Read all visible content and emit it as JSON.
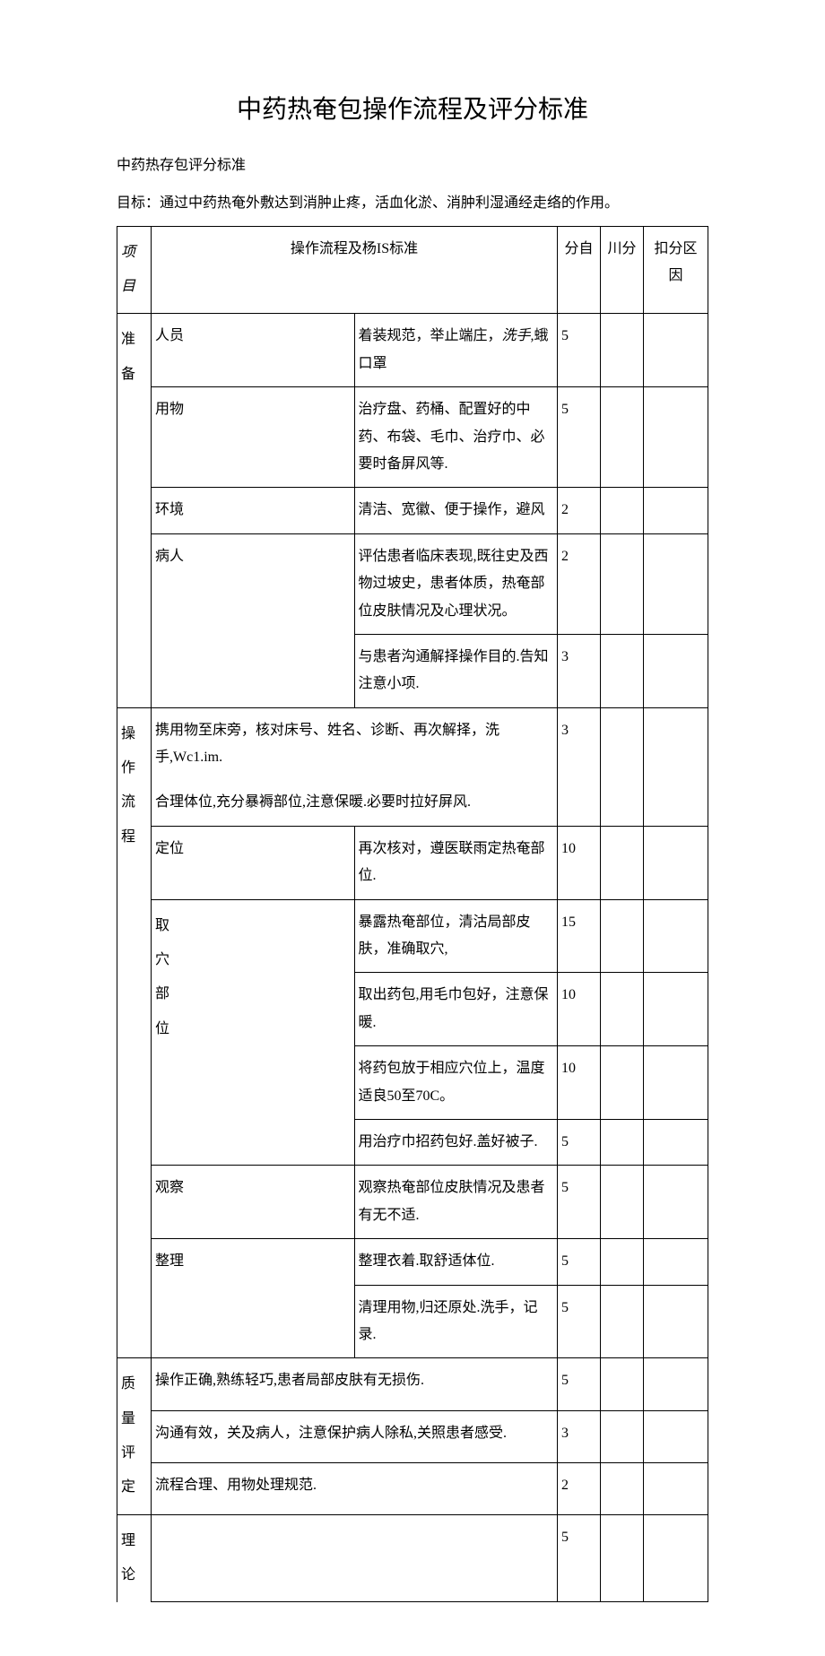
{
  "title": "中药热奄包操作流程及评分标准",
  "subtitle": "中药热存包评分标准",
  "goal": "目标：通过中药热奄外敷达到消肿止疼，活血化淤、消肿利湿通经走络的作用。",
  "headers": {
    "category": "项目",
    "process": "操作流程及杨IS标准",
    "score": "分自",
    "deduct": "川分",
    "reason": "扣分区因"
  },
  "categories": {
    "prep": "准备",
    "process": "操作流程",
    "quality": "质量评定",
    "theory": "理论"
  },
  "subs": {
    "personnel": "人员",
    "materials": "用物",
    "environment": "环境",
    "patient": "病人",
    "location": "定位",
    "acupoint": "取穴部位",
    "observe": "观察",
    "tidy": "整理"
  },
  "rows": {
    "r1": {
      "desc": "着装规范，举止端庄，洗手,蛾口罩",
      "score": "5"
    },
    "r2": {
      "desc": "治疗盘、药桶、配置好的中药、布袋、毛巾、治疗巾、必要时备屏风等.",
      "score": "5"
    },
    "r3": {
      "desc": "清洁、宽徽、便于操作，避风",
      "score": "2"
    },
    "r4": {
      "desc": "评估患者临床表现,既往史及西物过坡史，患者体质，热奄部位皮肤情况及心理状况。",
      "score": "2"
    },
    "r5": {
      "desc": "与患者沟通解择操作目的.告知注意小项.",
      "score": "3"
    },
    "r6": {
      "desc": "携用物至床旁，核对床号、姓名、诊断、再次解择，洗手,Wc1.im.",
      "score": "3"
    },
    "r7": {
      "desc": "合理体位,充分暴褥部位,注意保暖.必要时拉好屏风.",
      "score": ""
    },
    "r8": {
      "desc": "再次核对，遵医联雨定热奄部位.",
      "score": "10"
    },
    "r9": {
      "desc": "暴露热奄部位，清沽局部皮肤，准确取穴,",
      "score": "15"
    },
    "r10": {
      "desc": "取出药包,用毛巾包好，注意保暖.",
      "score": "10"
    },
    "r11": {
      "desc": "将药包放于相应穴位上，温度适良50至70C。",
      "score": "10"
    },
    "r12": {
      "desc": "用治疗巾招药包好.盖好被子.",
      "score": "5"
    },
    "r13": {
      "desc": "观察热奄部位皮肤情况及患者有无不适.",
      "score": "5"
    },
    "r14": {
      "desc": "整理衣着.取舒适体位.",
      "score": "5"
    },
    "r15": {
      "desc": "清理用物,归还原处.洗手，记录.",
      "score": "5"
    },
    "r16": {
      "desc": "操作正确,熟练轻巧,患者局部皮肤有无损伤.",
      "score": "5"
    },
    "r17": {
      "desc": "沟通有效，关及病人，注意保护病人除私,关照患者感受.",
      "score": "3"
    },
    "r18": {
      "desc": "流程合理、用物处理规范.",
      "score": "2"
    },
    "r19": {
      "desc": "",
      "score": "5"
    }
  },
  "italic_parts": {
    "xishou": "洗手,"
  }
}
